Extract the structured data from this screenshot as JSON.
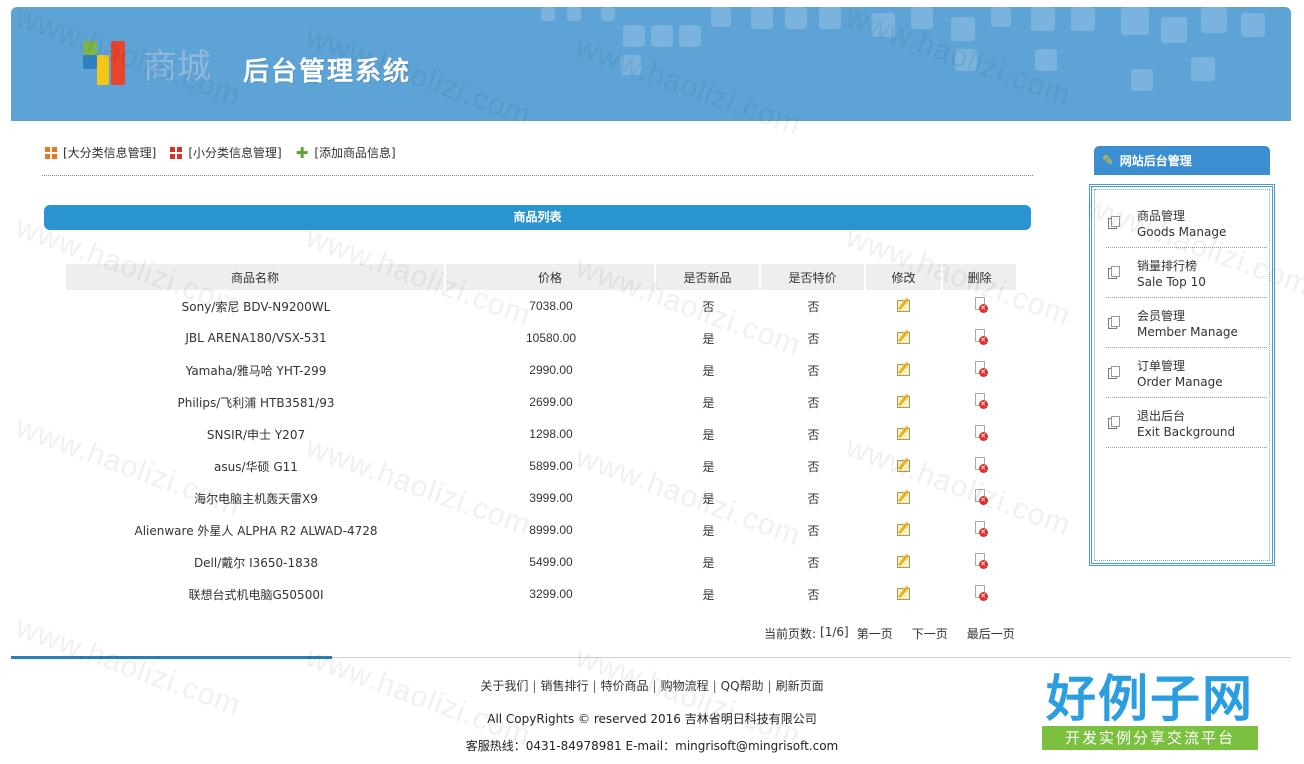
{
  "header": {
    "logo_number": "51",
    "logo_text": "商城",
    "system_title": "后台管理系统"
  },
  "top_links": [
    {
      "label": "[大分类信息管理]"
    },
    {
      "label": "[小分类信息管理]"
    },
    {
      "label": "[添加商品信息]"
    }
  ],
  "list_title": "商品列表",
  "table": {
    "headers": {
      "name": "商品名称",
      "price": "价格",
      "is_new": "是否新品",
      "is_special": "是否特价",
      "edit": "修改",
      "delete": "删除"
    },
    "rows": [
      {
        "name": "Sony/索尼 BDV-N9200WL",
        "price": "7038.00",
        "is_new": "否",
        "is_special": "否"
      },
      {
        "name": "JBL ARENA180/VSX-531",
        "price": "10580.00",
        "is_new": "是",
        "is_special": "否"
      },
      {
        "name": "Yamaha/雅马哈 YHT-299",
        "price": "2990.00",
        "is_new": "是",
        "is_special": "否"
      },
      {
        "name": "Philips/飞利浦 HTB3581/93",
        "price": "2699.00",
        "is_new": "是",
        "is_special": "否"
      },
      {
        "name": "SNSIR/申士 Y207",
        "price": "1298.00",
        "is_new": "是",
        "is_special": "否"
      },
      {
        "name": "asus/华硕 G11",
        "price": "5899.00",
        "is_new": "是",
        "is_special": "否"
      },
      {
        "name": "海尔电脑主机轰天雷X9",
        "price": "3999.00",
        "is_new": "是",
        "is_special": "否"
      },
      {
        "name": "Alienware 外星人 ALPHA R2 ALWAD-4728",
        "price": "8999.00",
        "is_new": "是",
        "is_special": "否"
      },
      {
        "name": "Dell/戴尔 I3650-1838",
        "price": "5499.00",
        "is_new": "是",
        "is_special": "否"
      },
      {
        "name": "联想台式机电脑G50500I",
        "price": "3299.00",
        "is_new": "是",
        "is_special": "否"
      }
    ]
  },
  "pager": {
    "current_label": "当前页数:",
    "current_value": "[1/6]",
    "first": "第一页",
    "next": "下一页",
    "last": "最后一页"
  },
  "sidebar": {
    "title": "网站后台管理",
    "items": [
      {
        "cn": "商品管理",
        "en": "Goods Manage"
      },
      {
        "cn": "销量排行榜",
        "en": "Sale Top 10"
      },
      {
        "cn": "会员管理",
        "en": "Member Manage"
      },
      {
        "cn": "订单管理",
        "en": "Order Manage"
      },
      {
        "cn": "退出后台",
        "en": "Exit Background"
      }
    ]
  },
  "footer": {
    "links": [
      "关于我们",
      "销售排行",
      "特价商品",
      "购物流程",
      "QQ帮助",
      "刷新页面"
    ],
    "copyright": "All CopyRights © reserved 2016 吉林省明日科技有限公司",
    "contact": "客服热线：0431-84978981 E-mail：mingrisoft@mingrisoft.com"
  },
  "watermark": {
    "text": "www.haolizi.com",
    "brand_title": "好例子网",
    "brand_sub": "开发实例分享交流平台"
  },
  "colors": {
    "header_bg": "#5da3d6",
    "accent_blue": "#2a94d0",
    "brand_green": "#7cc040"
  }
}
